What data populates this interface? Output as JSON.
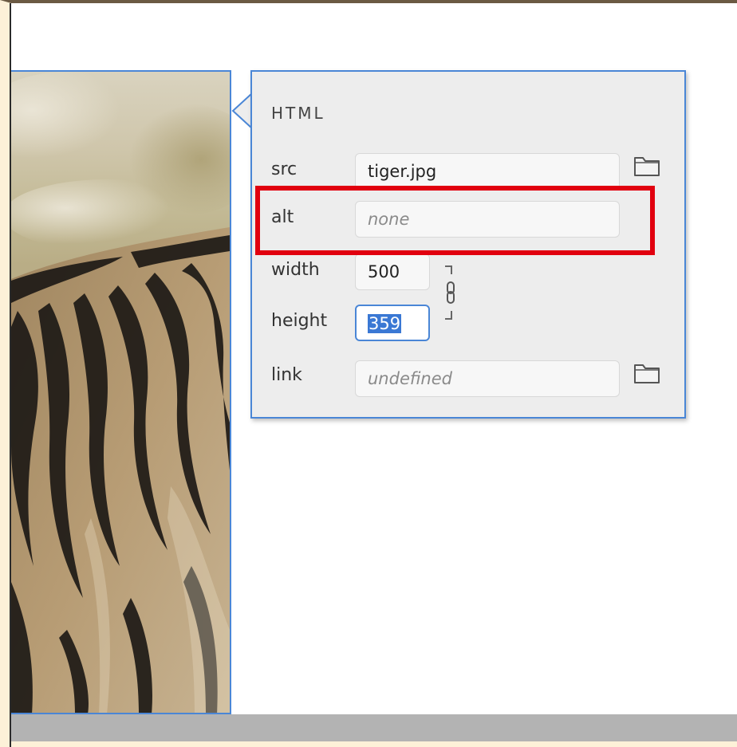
{
  "editor": {
    "image_description_icon": "tiger-photo"
  },
  "popup": {
    "title": "HTML",
    "fields": {
      "src": {
        "label": "src",
        "value": "tiger.jpg"
      },
      "alt": {
        "label": "alt",
        "placeholder": "none"
      },
      "width": {
        "label": "width",
        "value": "500"
      },
      "height": {
        "label": "height",
        "value": "359"
      },
      "link": {
        "label": "link",
        "placeholder": "undefined"
      }
    },
    "icons": {
      "src_browse": "folder-icon",
      "link_browse": "folder-icon",
      "aspect_lock": "chain-link-icon"
    }
  },
  "annotation": {
    "color": "#e1000f"
  },
  "colors": {
    "accent": "#4a86d6",
    "selection": "#3a78d4",
    "panel_bg": "#ededed"
  }
}
